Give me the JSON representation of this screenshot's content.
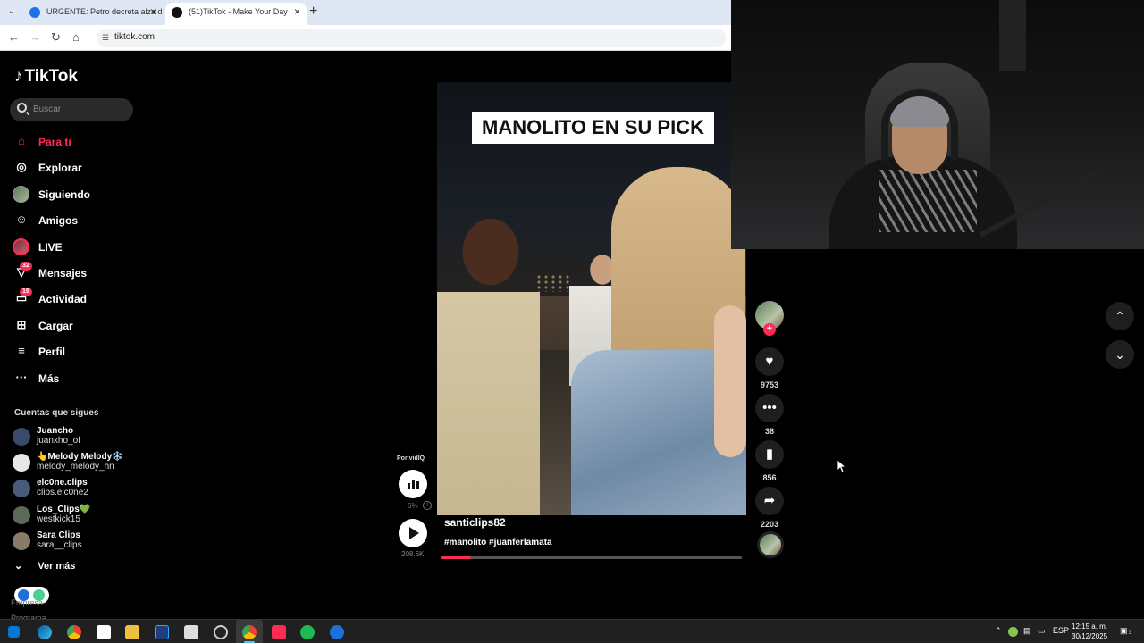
{
  "browser": {
    "tabs": [
      {
        "label": "URGENTE: Petro decreta alza d",
        "active": false,
        "favicon_color": "#1a73e8"
      },
      {
        "label": "(51)TikTok - Make Your Day",
        "active": true,
        "favicon_color": "#111111"
      }
    ],
    "new_tab_label": "+",
    "url": "tiktok.com"
  },
  "tiktok": {
    "logo_text": "TikTok",
    "search_placeholder": "Buscar",
    "nav": [
      {
        "label": "Para ti",
        "icon": "home-icon",
        "active": true
      },
      {
        "label": "Explorar",
        "icon": "compass-icon",
        "active": false
      },
      {
        "label": "Siguiendo",
        "icon": "following-avatar-icon",
        "active": false
      },
      {
        "label": "Amigos",
        "icon": "friends-icon",
        "active": false
      },
      {
        "label": "LIVE",
        "icon": "live-icon",
        "active": false
      },
      {
        "label": "Mensajes",
        "icon": "messages-icon",
        "badge": "32",
        "active": false
      },
      {
        "label": "Actividad",
        "icon": "activity-icon",
        "badge": "19",
        "active": false
      },
      {
        "label": "Cargar",
        "icon": "upload-icon",
        "active": false
      },
      {
        "label": "Perfil",
        "icon": "profile-icon",
        "active": false
      },
      {
        "label": "Más",
        "icon": "more-icon",
        "active": false
      }
    ],
    "following_title": "Cuentas que sigues",
    "following": [
      {
        "name": "Juancho",
        "username": "juanxho_of",
        "avatar_color": "#3b4a6b"
      },
      {
        "name": "👆Melody Melody❄️",
        "username": "melody_melody_hn",
        "avatar_color": "#e8e8e8"
      },
      {
        "name": "elc0ne.clips",
        "username": "clips.elc0ne2",
        "avatar_color": "#4a5a7a"
      },
      {
        "name": "Los_Clips💚",
        "username": "westkick15",
        "avatar_color": "#5a6a5a"
      },
      {
        "name": "Sara Clips",
        "username": "sara__clips",
        "avatar_color": "#8a7a6a"
      }
    ],
    "see_more": "Ver más",
    "footer_1": "Empresa",
    "footer_2": "Programa",
    "video": {
      "overlay_caption": "MANOLITO EN SU PICK",
      "author": "santiclips82",
      "hashtags": "#manolito #juanferlamata",
      "progress": 0.1
    },
    "vidiq": {
      "label": "Por vidIQ",
      "percent": "6%",
      "play_count": "208.6K"
    },
    "actions": {
      "likes": "9753",
      "comments": "38",
      "saves": "856",
      "shares": "2203"
    }
  },
  "taskbar": {
    "language": "ESP",
    "time": "12:15 a. m.",
    "date": "30/12/2025",
    "notif_count": "3"
  },
  "colors": {
    "accent": "#fe2c55",
    "background": "#000000"
  }
}
